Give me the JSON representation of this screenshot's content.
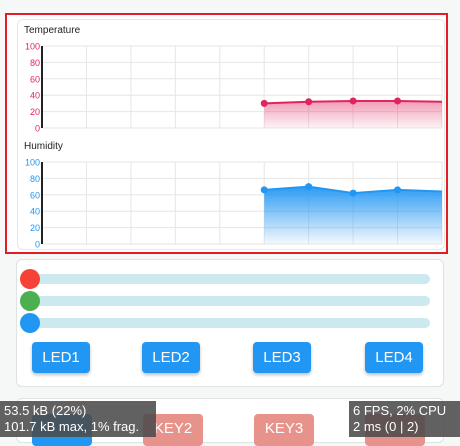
{
  "colors": {
    "panel_border": "#e21d25",
    "temp": "#e0245e",
    "hum": "#2196f3",
    "led_button": "#2196f3",
    "key_button": "#e8928c"
  },
  "chart_data": [
    {
      "type": "area",
      "title": "Temperature",
      "ylim": [
        0,
        100
      ],
      "y_ticks": [
        "100",
        "80",
        "60",
        "40",
        "20",
        "0"
      ],
      "points": 10,
      "series": [
        {
          "values": [
            null,
            null,
            null,
            null,
            null,
            30,
            32,
            33,
            33,
            32
          ]
        }
      ],
      "grid": true
    },
    {
      "type": "area",
      "title": "Humidity",
      "ylim": [
        0,
        100
      ],
      "y_ticks": [
        "100",
        "80",
        "60",
        "40",
        "20",
        "0"
      ],
      "points": 10,
      "series": [
        {
          "values": [
            null,
            null,
            null,
            null,
            null,
            66,
            70,
            62,
            66,
            64
          ]
        }
      ],
      "grid": true
    }
  ],
  "controls": {
    "sliders": [
      {
        "name": "red",
        "color": "#f44336",
        "value": 0
      },
      {
        "name": "green",
        "color": "#4caf50",
        "value": 0
      },
      {
        "name": "blue",
        "color": "#2196f3",
        "value": 0
      }
    ],
    "leds": [
      "LED1",
      "LED2",
      "LED3",
      "LED4"
    ]
  },
  "keys": [
    "KEY2",
    "KEY3"
  ],
  "stats": {
    "mem_line1": "53.5 kB (22%)",
    "mem_line2": "101.7 kB max, 1% frag.",
    "perf_line1": "6 FPS, 2% CPU",
    "perf_line2": "2 ms (0 | 2)"
  }
}
